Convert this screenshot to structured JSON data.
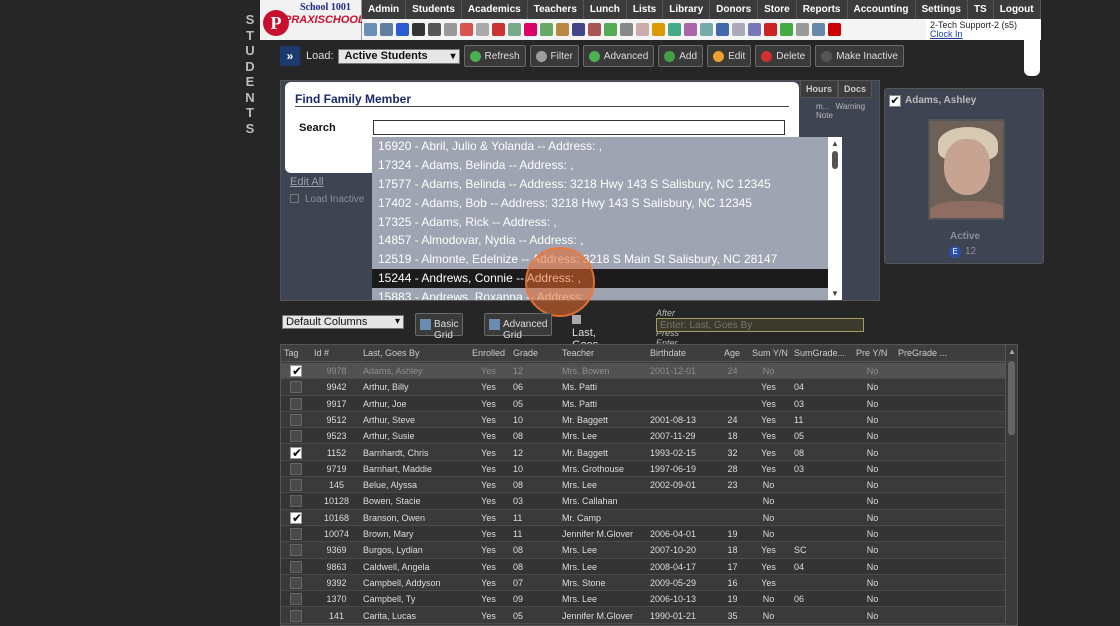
{
  "sidebar": {
    "letters": [
      "S",
      "T",
      "U",
      "D",
      "E",
      "N",
      "T",
      "S"
    ]
  },
  "logo": {
    "school": "School 1001",
    "letter": "P",
    "brand": "PRAXISCHOOL"
  },
  "menu": [
    "Admin",
    "Students",
    "Academics",
    "Teachers",
    "Lunch",
    "Lists",
    "Library",
    "Donors",
    "Store",
    "Reports",
    "Accounting",
    "Settings",
    "TS",
    "Logout"
  ],
  "user": {
    "name": "2-Tech Support-2 (s5)",
    "clock": "Clock In"
  },
  "toolbar": {
    "load_label": "Load:",
    "load_value": "Active Students",
    "buttons": [
      {
        "label": "Refresh",
        "color": "#4caf50"
      },
      {
        "label": "Filter",
        "color": "#9e9e9e"
      },
      {
        "label": "Advanced",
        "color": "#4caf50"
      },
      {
        "label": "Add",
        "color": "#43a047"
      },
      {
        "label": "Edit",
        "color": "#f0a030"
      },
      {
        "label": "Delete",
        "color": "#d32f2f"
      },
      {
        "label": "Make Inactive",
        "color": "#555555"
      }
    ]
  },
  "panel": {
    "edit_all": "Edit All",
    "load_inactive": "Load Inactive",
    "tab_hours": "Hours",
    "tab_docs": "Docs",
    "col_m": "m...",
    "col_warning": "Warning Note"
  },
  "profile": {
    "name": "Adams, Ashley",
    "status": "Active",
    "grade_badge": "E",
    "grade": "12"
  },
  "modal": {
    "title": "Find Family Member",
    "search_label": "Search",
    "search_value": "",
    "results": [
      "16920 - Abril, Julio & Yolanda -- Address: ,",
      "17324 - Adams, Belinda -- Address: ,",
      "17577 - Adams, Belinda -- Address: 3218 Hwy 143 S Salisbury, NC 12345",
      "17402 - Adams, Bob -- Address: 3218 Hwy 143 S Salisbury, NC 12345",
      "17325 - Adams, Rick -- Address: ,",
      "14857 - Almodovar, Nydia -- Address: ,",
      "12519 - Almonte, Edelnize -- Address: 3218 S Main St Salisbury, NC 28147",
      "15244 - Andrews, Connie -- Address: ,",
      "15883 - Andrews, Roxanna -- Address: ,"
    ],
    "selected_index": 7
  },
  "grid_controls": {
    "columns_value": "Default Columns",
    "basic_grid": "Basic Grid",
    "advanced_grid": "Advanced Grid",
    "last_goes_by": "Last, Goes By",
    "hint": "After Searching Press Enter, Tab or Click Out of Box",
    "search_placeholder": "Enter: Last, Goes By"
  },
  "grid": {
    "headers": [
      "Tag",
      "Id #",
      "Last, Goes By",
      "Enrolled",
      "Grade",
      "Teacher",
      "Birthdate",
      "Age",
      "Sum Y/N",
      "SumGrade...",
      "Pre Y/N",
      "PreGrade ..."
    ],
    "rows": [
      {
        "tag": true,
        "id": "9978",
        "name": "Adams, Ashley",
        "enrolled": "Yes",
        "grade": "12",
        "teacher": "Mrs. Bowen",
        "birth": "2001-12-01",
        "age": "24",
        "sum": "No",
        "sumgrade": "",
        "pre": "No",
        "highlight": true
      },
      {
        "tag": false,
        "id": "9942",
        "name": "Arthur, Billy",
        "enrolled": "Yes",
        "grade": "06",
        "teacher": "Ms. Patti",
        "birth": "",
        "age": "",
        "sum": "Yes",
        "sumgrade": "04",
        "pre": "No"
      },
      {
        "tag": false,
        "id": "9917",
        "name": "Arthur, Joe",
        "enrolled": "Yes",
        "grade": "05",
        "teacher": "Ms. Patti",
        "birth": "",
        "age": "",
        "sum": "Yes",
        "sumgrade": "03",
        "pre": "No"
      },
      {
        "tag": false,
        "id": "9512",
        "name": "Arthur, Steve",
        "enrolled": "Yes",
        "grade": "10",
        "teacher": "Mr. Baggett",
        "birth": "2001-08-13",
        "age": "24",
        "sum": "Yes",
        "sumgrade": "11",
        "pre": "No"
      },
      {
        "tag": false,
        "id": "9523",
        "name": "Arthur, Susie",
        "enrolled": "Yes",
        "grade": "08",
        "teacher": "Mrs. Lee",
        "birth": "2007-11-29",
        "age": "18",
        "sum": "Yes",
        "sumgrade": "05",
        "pre": "No"
      },
      {
        "tag": true,
        "id": "1152",
        "name": "Barnhardt, Chris",
        "enrolled": "Yes",
        "grade": "12",
        "teacher": "Mr. Baggett",
        "birth": "1993-02-15",
        "age": "32",
        "sum": "Yes",
        "sumgrade": "08",
        "pre": "No"
      },
      {
        "tag": false,
        "id": "9719",
        "name": "Barnhart, Maddie",
        "enrolled": "Yes",
        "grade": "10",
        "teacher": "Mrs. Grothouse",
        "birth": "1997-06-19",
        "age": "28",
        "sum": "Yes",
        "sumgrade": "03",
        "pre": "No"
      },
      {
        "tag": false,
        "id": "145",
        "name": "Belue, Alyssa",
        "enrolled": "Yes",
        "grade": "08",
        "teacher": "Mrs. Lee",
        "birth": "2002-09-01",
        "age": "23",
        "sum": "No",
        "sumgrade": "",
        "pre": "No"
      },
      {
        "tag": false,
        "id": "10128",
        "name": "Bowen, Stacie",
        "enrolled": "Yes",
        "grade": "03",
        "teacher": "Mrs. Callahan",
        "birth": "",
        "age": "",
        "sum": "No",
        "sumgrade": "",
        "pre": "No"
      },
      {
        "tag": true,
        "id": "10168",
        "name": "Branson, Owen",
        "enrolled": "Yes",
        "grade": "11",
        "teacher": "Mr. Camp",
        "birth": "",
        "age": "",
        "sum": "No",
        "sumgrade": "",
        "pre": "No"
      },
      {
        "tag": false,
        "id": "10074",
        "name": "Brown, Mary",
        "enrolled": "Yes",
        "grade": "11",
        "teacher": "Jennifer M.Glover",
        "birth": "2006-04-01",
        "age": "19",
        "sum": "No",
        "sumgrade": "",
        "pre": "No"
      },
      {
        "tag": false,
        "id": "9369",
        "name": "Burgos, Lydian",
        "enrolled": "Yes",
        "grade": "08",
        "teacher": "Mrs. Lee",
        "birth": "2007-10-20",
        "age": "18",
        "sum": "Yes",
        "sumgrade": "SC",
        "pre": "No"
      },
      {
        "tag": false,
        "id": "9863",
        "name": "Caldwell, Angela",
        "enrolled": "Yes",
        "grade": "08",
        "teacher": "Mrs. Lee",
        "birth": "2008-04-17",
        "age": "17",
        "sum": "Yes",
        "sumgrade": "04",
        "pre": "No"
      },
      {
        "tag": false,
        "id": "9392",
        "name": "Campbell, Addyson",
        "enrolled": "Yes",
        "grade": "07",
        "teacher": "Mrs. Stone",
        "birth": "2009-05-29",
        "age": "16",
        "sum": "Yes",
        "sumgrade": "",
        "pre": "No"
      },
      {
        "tag": false,
        "id": "1370",
        "name": "Campbell, Ty",
        "enrolled": "Yes",
        "grade": "09",
        "teacher": "Mrs. Lee",
        "birth": "2006-10-13",
        "age": "19",
        "sum": "No",
        "sumgrade": "06",
        "pre": "No"
      },
      {
        "tag": false,
        "id": "141",
        "name": "Carita, Lucas",
        "enrolled": "Yes",
        "grade": "05",
        "teacher": "Jennifer M.Glover",
        "birth": "1990-01-21",
        "age": "35",
        "sum": "No",
        "sumgrade": "",
        "pre": "No"
      }
    ]
  }
}
